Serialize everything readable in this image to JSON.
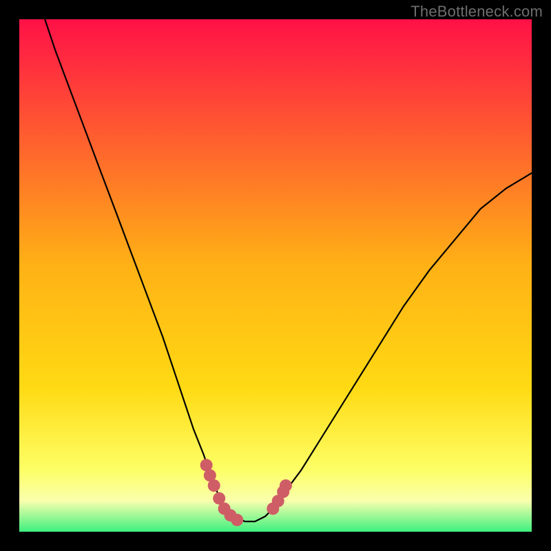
{
  "watermark": "TheBottleneck.com",
  "colors": {
    "frame": "#000000",
    "gradient_top": "#ff1147",
    "gradient_mid": "#ffda14",
    "gradient_low": "#fdff66",
    "gradient_bottom_yellow": "#f9ffad",
    "gradient_bottom_green": "#3df07e",
    "curve": "#000000",
    "markers": "#cf5d66"
  },
  "chart_data": {
    "type": "line",
    "title": "",
    "xlabel": "",
    "ylabel": "",
    "xlim": [
      0,
      100
    ],
    "ylim": [
      0,
      100
    ],
    "curve": {
      "name": "bottleneck-curve",
      "x": [
        5,
        7,
        10,
        13,
        16,
        19,
        22,
        25,
        28,
        30,
        32,
        34,
        36,
        37,
        38,
        39,
        40,
        42,
        44,
        46,
        48,
        50,
        52,
        55,
        60,
        65,
        70,
        75,
        80,
        85,
        90,
        95,
        100
      ],
      "y": [
        100,
        94,
        86,
        78,
        70,
        62,
        54,
        46,
        38,
        32,
        26,
        20,
        15,
        12,
        9,
        7,
        5,
        3,
        2,
        2,
        3,
        5,
        8,
        12,
        20,
        28,
        36,
        44,
        51,
        57,
        63,
        67,
        70
      ]
    },
    "marker_clusters": [
      {
        "name": "left-edge-markers",
        "x": [
          36.5,
          37.2,
          38.0,
          39.0,
          40.0,
          41.2,
          42.5
        ],
        "y": [
          13.0,
          11.0,
          9.0,
          6.5,
          4.5,
          3.2,
          2.3
        ]
      },
      {
        "name": "right-edge-markers",
        "x": [
          49.5,
          50.5,
          51.5,
          52.0
        ],
        "y": [
          4.5,
          6.0,
          7.8,
          9.0
        ]
      }
    ]
  }
}
